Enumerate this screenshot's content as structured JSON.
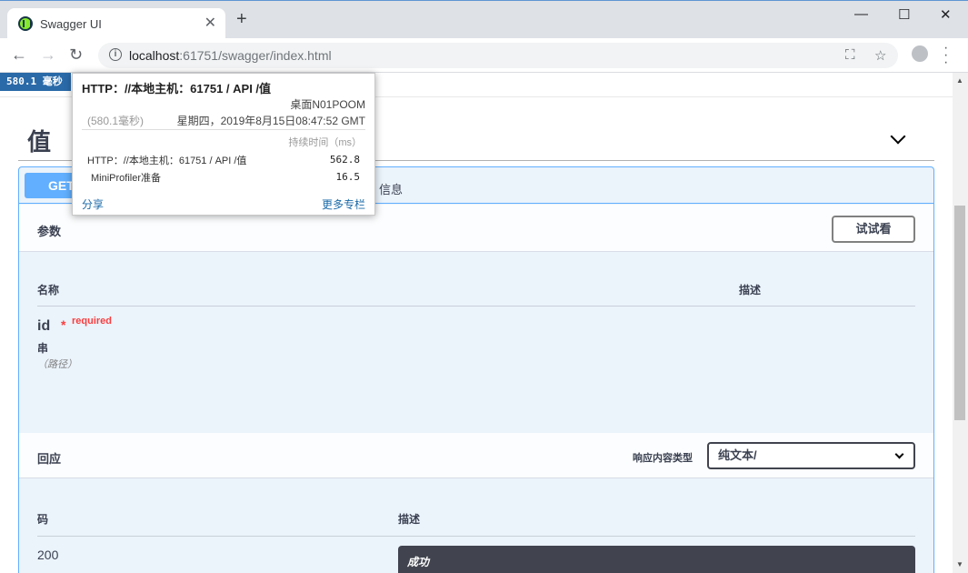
{
  "browser": {
    "tab_title": "Swagger UI",
    "tab_close": "✕",
    "new_tab": "+",
    "url_host": "localhost",
    "url_rest": ":61751/swagger/index.html",
    "minimize": "—",
    "maximize": "☐",
    "close": "✕"
  },
  "profiler": {
    "badge": "580.1 毫秒",
    "name": "HTTP：//本地主机：61751 / API /值",
    "machine": "桌面N01POOM",
    "duration": "(580.1毫秒)",
    "date": "星期四，2019年8月15日08:47:52 GMT",
    "column_head": "持续时间（ms）",
    "rows": [
      {
        "label": "HTTP：//本地主机：61751 / API /值",
        "value": "562.8"
      },
      {
        "label": "MiniProfiler准备",
        "value": "16.5"
      }
    ],
    "share": "分享",
    "more_columns": "更多专栏"
  },
  "swagger": {
    "section_title": "值",
    "method": "GET",
    "op_desc_tail": "信息",
    "parameters_title": "参数",
    "try_button": "试试看",
    "col_name": "名称",
    "col_description": "描述",
    "param": {
      "name": "id",
      "required_star": "*",
      "required_text": "required",
      "type": "串",
      "in": "（路径）"
    },
    "responses_title": "回应",
    "content_type_label": "响应内容类型",
    "content_type_value": "纯文本/",
    "resp_col_code": "码",
    "resp_col_description": "描述",
    "response_code": "200",
    "response_desc": "成功"
  }
}
